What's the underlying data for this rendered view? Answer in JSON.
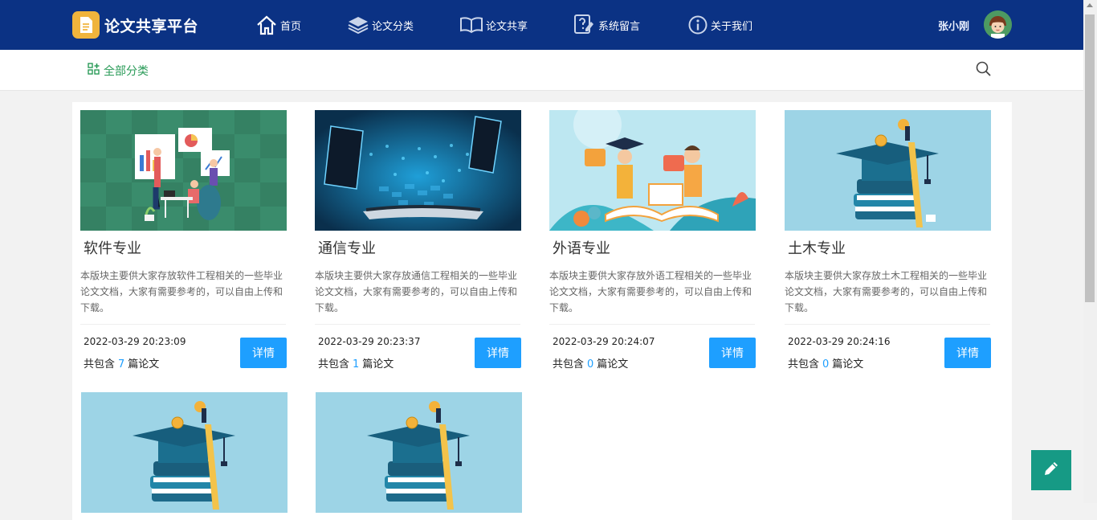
{
  "header": {
    "brand": "论文共享平台",
    "nav": [
      {
        "label": "首页",
        "icon": "home-icon"
      },
      {
        "label": "论文分类",
        "icon": "layers-icon"
      },
      {
        "label": "论文共享",
        "icon": "open-book-icon"
      },
      {
        "label": "系统留言",
        "icon": "question-note-icon"
      },
      {
        "label": "关于我们",
        "icon": "info-icon"
      }
    ],
    "user_name": "张小刚"
  },
  "subbar": {
    "all_categories": "全部分类",
    "search_icon": "search-icon"
  },
  "cards": [
    {
      "title": "软件专业",
      "desc": "本版块主要供大家存放软件工程相关的一些毕业论文文档，大家有需要参考的，可以自由上传和下载。",
      "date": "2022-03-29 20:23:09",
      "count_prefix": "共包含",
      "count": "7",
      "count_suffix": "篇论文",
      "button": "详情"
    },
    {
      "title": "通信专业",
      "desc": "本版块主要供大家存放通信工程相关的一些毕业论文文档，大家有需要参考的，可以自由上传和下载。",
      "date": "2022-03-29 20:23:37",
      "count_prefix": "共包含",
      "count": "1",
      "count_suffix": "篇论文",
      "button": "详情"
    },
    {
      "title": "外语专业",
      "desc": "本版块主要供大家存放外语工程相关的一些毕业论文文档，大家有需要参考的，可以自由上传和下载。",
      "date": "2022-03-29 20:24:07",
      "count_prefix": "共包含",
      "count": "0",
      "count_suffix": "篇论文",
      "button": "详情"
    },
    {
      "title": "土木专业",
      "desc": "本版块主要供大家存放土木工程相关的一些毕业论文文档，大家有需要参考的，可以自由上传和下载。",
      "date": "2022-03-29 20:24:16",
      "count_prefix": "共包含",
      "count": "0",
      "count_suffix": "篇论文",
      "button": "详情"
    }
  ],
  "edit_fab_icon": "pencil-icon",
  "colors": {
    "header_bg": "#0b3284",
    "accent_blue": "#1e9fff",
    "green": "#2a9b58",
    "fab": "#169a85"
  }
}
